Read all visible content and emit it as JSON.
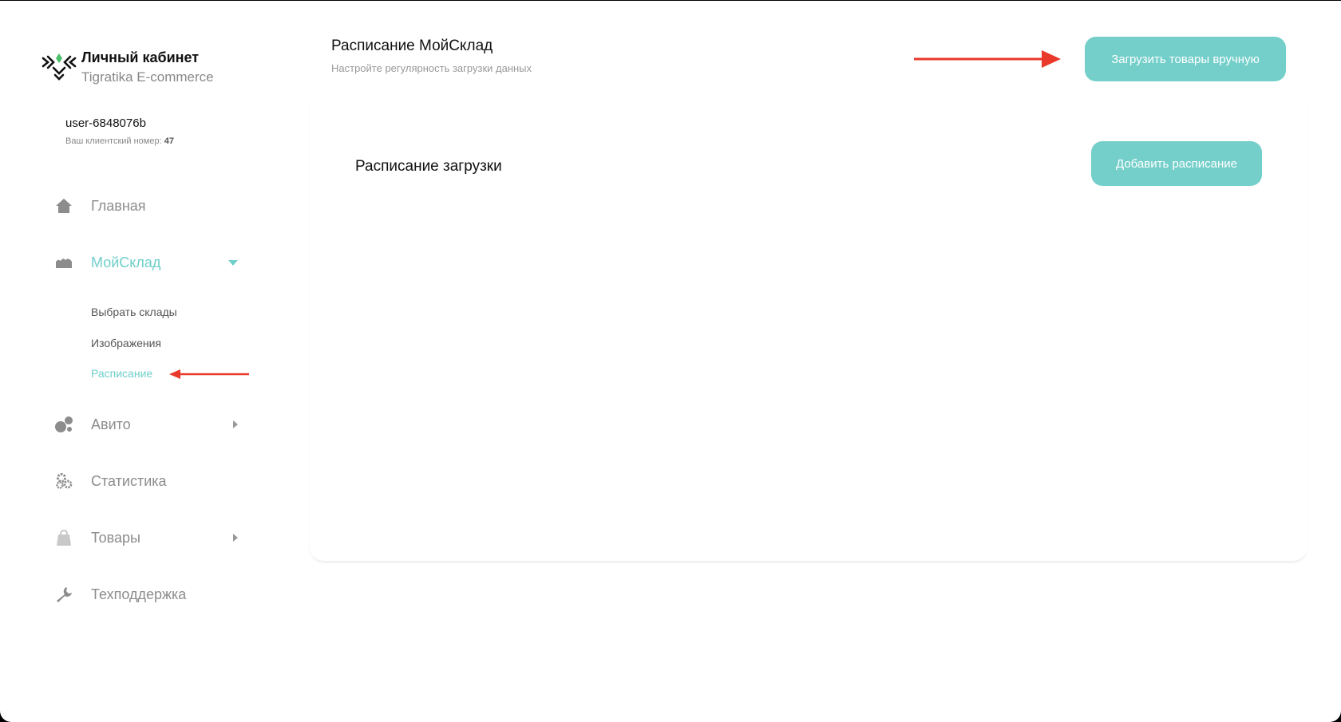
{
  "sidebar": {
    "logo_title": "Личный кабинет",
    "logo_subtitle": "Tigratika E-commerce",
    "user_name": "user-6848076b",
    "client_label": "Ваш клиентский номер:",
    "client_number": "47",
    "nav": {
      "home": "Главная",
      "moysklad": "МойСклад",
      "avito": "Авито",
      "stats": "Статистика",
      "goods": "Товары",
      "support": "Техподдержка"
    },
    "sub": {
      "warehouses": "Выбрать склады",
      "images": "Изображения",
      "schedule": "Расписание"
    }
  },
  "main": {
    "title": "Расписание МойСклад",
    "subtitle": "Настройте регулярность загрузки данных",
    "load_button": "Загрузить товары вручную",
    "section_title": "Расписание загрузки",
    "add_button": "Добавить расписание"
  },
  "colors": {
    "accent": "#74cfca",
    "annotation_arrow": "#e8392a",
    "muted": "#8c8c8c"
  },
  "icons": {
    "logo": "tiger-logo-icon",
    "home": "home-icon",
    "moysklad": "warehouse-icon",
    "avito": "avito-dots-icon",
    "stats": "gears-icon",
    "goods": "bag-icon",
    "support": "wrench-icon"
  }
}
